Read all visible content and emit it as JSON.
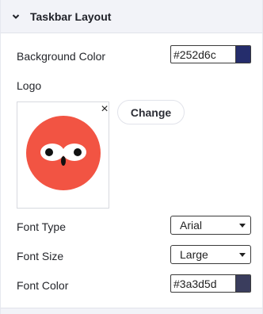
{
  "section": {
    "title": "Taskbar Layout",
    "expanded": true
  },
  "background_color": {
    "label": "Background Color",
    "value": "#252d6c",
    "swatch": "#252d6c"
  },
  "logo": {
    "label": "Logo",
    "change_label": "Change",
    "remove_icon": "×",
    "image": {
      "circle_color": "#f25443",
      "eye_color": "#ffffff",
      "pupil_color": "#111111"
    }
  },
  "font_type": {
    "label": "Font Type",
    "selected": "Arial"
  },
  "font_size": {
    "label": "Font Size",
    "selected": "Large"
  },
  "font_color": {
    "label": "Font Color",
    "value": "#3a3d5d",
    "swatch": "#3a3d5d"
  }
}
